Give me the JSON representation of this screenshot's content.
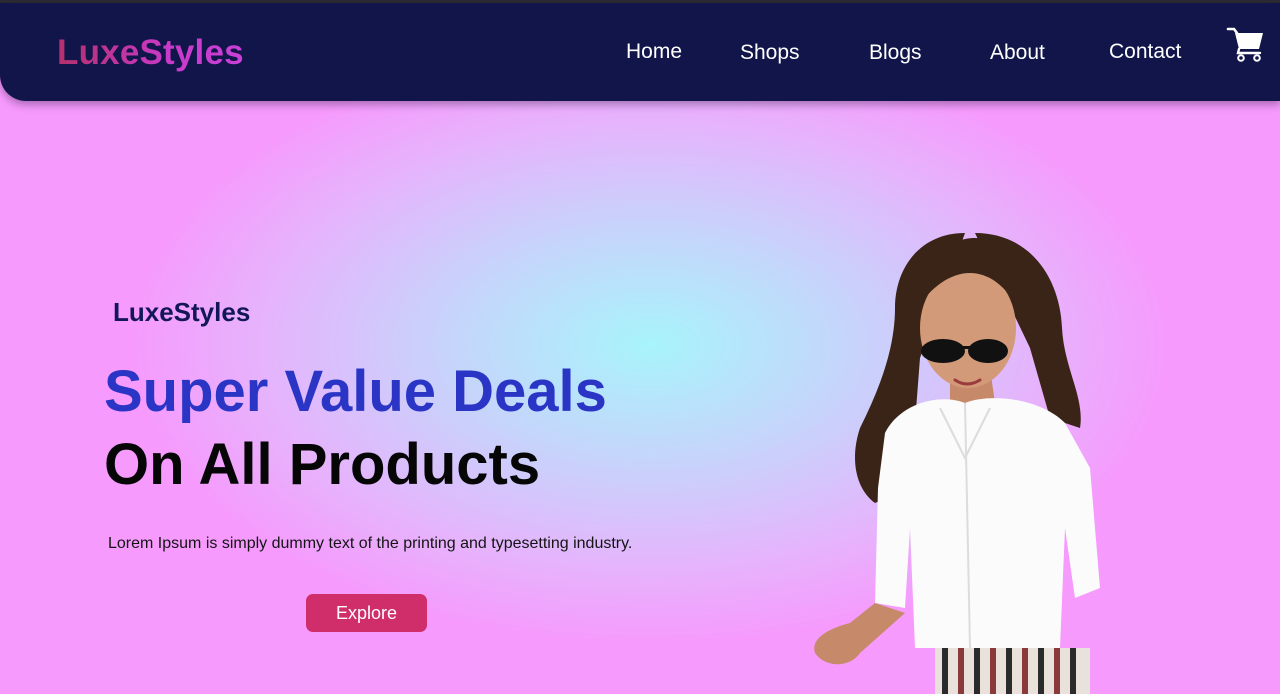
{
  "header": {
    "brand": "LuxeStyles",
    "nav": [
      {
        "label": "Home"
      },
      {
        "label": "Shops"
      },
      {
        "label": "Blogs"
      },
      {
        "label": "About"
      },
      {
        "label": "Contact"
      }
    ],
    "cart_icon": "shopping-cart-icon"
  },
  "hero": {
    "brand": "LuxeStyles",
    "headline_line1": "Super Value Deals",
    "headline_line2": "On All Products",
    "description": "Lorem Ipsum is simply dummy text of the printing and typesetting industry.",
    "cta_label": "Explore"
  },
  "colors": {
    "navbar": "#11154a",
    "brand_gradient_start": "#b4306c",
    "brand_gradient_end": "#c940d8",
    "headline_accent": "#2a35c6",
    "cta": "#d02e6a",
    "background_center": "#a8f4fb",
    "background_edge": "#f69afd"
  }
}
